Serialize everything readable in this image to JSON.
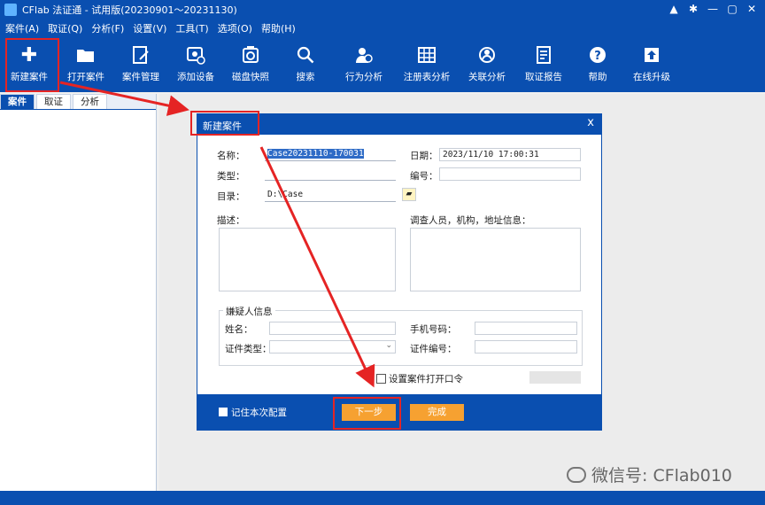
{
  "window": {
    "title": "CFlab 法证通 - 试用版(20230901～20231130)",
    "controls": [
      "▲",
      "✱",
      "—",
      "▢",
      "✕"
    ]
  },
  "menu": [
    "案件(A)",
    "取证(Q)",
    "分析(F)",
    "设置(V)",
    "工具(T)",
    "选项(O)",
    "帮助(H)"
  ],
  "toolbar": [
    {
      "label": "新建案件",
      "icon": "plus-icon",
      "glyph": "✚"
    },
    {
      "label": "打开案件",
      "icon": "folder-open-icon",
      "glyph": "📂"
    },
    {
      "label": "案件管理",
      "icon": "case-manage-icon",
      "glyph": "✎"
    },
    {
      "label": "添加设备",
      "icon": "add-device-icon",
      "glyph": "⊕"
    },
    {
      "label": "磁盘快照",
      "icon": "disk-snapshot-icon",
      "glyph": "◎"
    },
    {
      "label": "搜索",
      "icon": "search-icon",
      "glyph": "⌕"
    },
    {
      "label": "行为分析",
      "icon": "behavior-analysis-icon",
      "glyph": "☍"
    },
    {
      "label": "注册表分析",
      "icon": "registry-icon",
      "glyph": "▦"
    },
    {
      "label": "关联分析",
      "icon": "link-analysis-icon",
      "glyph": "⊛"
    },
    {
      "label": "取证报告",
      "icon": "report-icon",
      "glyph": "▤"
    },
    {
      "label": "帮助",
      "icon": "help-icon",
      "glyph": "?"
    },
    {
      "label": "在线升级",
      "icon": "upgrade-icon",
      "glyph": "⬆"
    }
  ],
  "left_tabs": [
    "案件",
    "取证",
    "分析"
  ],
  "dialog": {
    "title": "新建案件",
    "close": "x",
    "name_label": "名称：",
    "name_value": "Case20231110-170031",
    "date_label": "日期：",
    "date_value": "2023/11/10 17:00:31",
    "type_label": "类型：",
    "number_label": "编号：",
    "dir_label": "目录：",
    "dir_value": "D:\\Case",
    "desc_label": "描述：",
    "investigator_label": "调查人员，机构，地址信息：",
    "suspect_group": "嫌疑人信息",
    "suspect_name_label": "姓名：",
    "phone_label": "手机号码：",
    "id_type_label": "证件类型：",
    "id_number_label": "证件编号：",
    "password_check_label": "设置案件打开口令",
    "remember_label": "记住本次配置",
    "next_button": "下一步",
    "finish_button": "完成"
  },
  "watermark": "微信号: CFlab010",
  "colors": {
    "primary_blue": "#0a4fb0",
    "button_orange": "#f6a131",
    "annotation_red": "#e52424"
  }
}
